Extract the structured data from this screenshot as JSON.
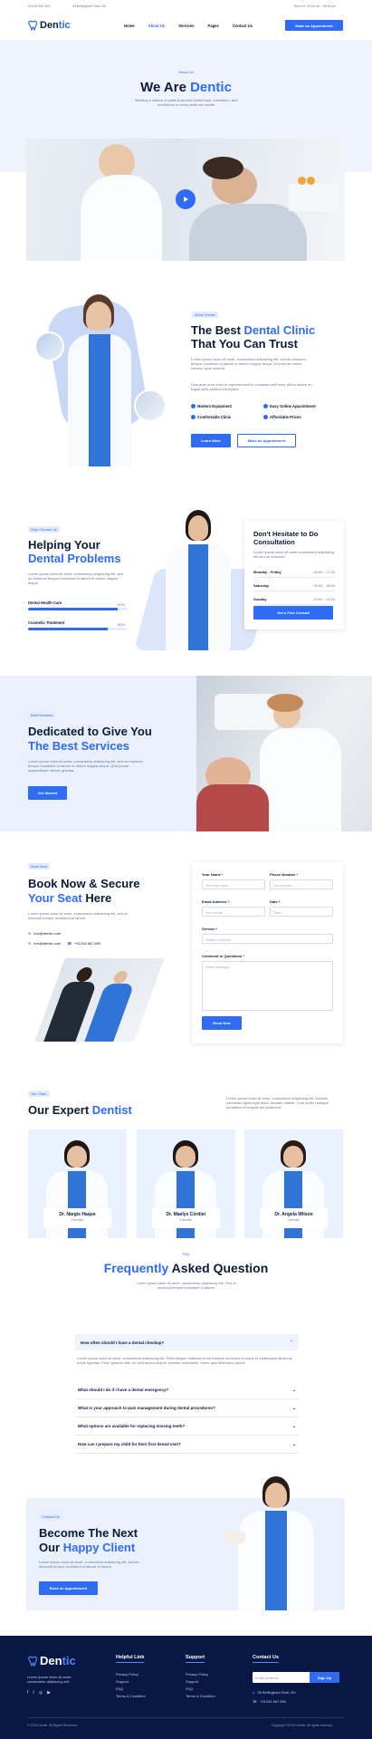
{
  "topbar": {
    "phone": "+01234 567 890",
    "address": "35 Bellingham Park, NV",
    "hours": "Mon-Fri: 09:00 am - 05:00 pm"
  },
  "nav": {
    "brand": "Dentic",
    "brand_prefix": "Den",
    "brand_suffix": "tic",
    "items": [
      "Home",
      "About Us",
      "Services",
      "Pages",
      "Contact Us"
    ],
    "active": "About Us",
    "cta": "Make an Appointment"
  },
  "hero": {
    "breadcrumb": "About Us",
    "title_a": "We Are ",
    "title_b": "Dentic",
    "sub": "Building a culture of patient-centred dental care, innovation, and excellence in every smile we create."
  },
  "about": {
    "tag": "About Dentic",
    "title_a": "The Best ",
    "title_b": "Dental Clinic",
    "title_c": "That You Can Trust",
    "p1": "Lorem ipsum dolor sit amet, consectetur adipiscing elit, sed do eiusmod tempor incididunt ut labore et dolore magna aliqua. Ut enim ad minim veniam, quis nostrud.",
    "p2": "Duis aute irure dolor in reprehenderit in voluptate velit esse cillum dolore eu fugiat nulla pariatur excepteur.",
    "features": [
      "Modern Equipment",
      "Easy Online Appointment",
      "Comfortable Clinic",
      "Affordable Prices"
    ],
    "btn1": "Learn More",
    "btn2": "Make an Appointment"
  },
  "problems": {
    "tag": "Why Choose Us",
    "title_a": "Helping Your",
    "title_b": "Dental Problems",
    "text": "Lorem ipsum dolor sit amet, consectetur adipiscing elit, sed do eiusmod tempor incididunt ut labore et dolore magna aliqua.",
    "skills": [
      {
        "label": "Dental Health Care",
        "value": "90%",
        "pct": 90
      },
      {
        "label": "Cosmetic Treatment",
        "value": "80%",
        "pct": 80
      }
    ],
    "consult": {
      "title": "Don't Hesitate to Do Consultation",
      "text": "Lorem ipsum dolor sit amet consectetur adipiscing elit sed do eiusmod.",
      "rows": [
        {
          "day": "Monday - Friday",
          "time": "08:00 - 17:00"
        },
        {
          "day": "Saturday",
          "time": "09:00 - 15:00"
        },
        {
          "day": "Sunday",
          "time": "10:00 - 13:00"
        }
      ],
      "btn": "Get a Free Consult"
    }
  },
  "services": {
    "tag": "Best Services",
    "title_a": "Dedicated to Give You",
    "title_b": "The Best Services",
    "text": "Lorem ipsum dolor sit amet, consectetur adipiscing elit, sed do eiusmod tempor incididunt ut labore et dolore magna aliqua. Quis ipsum suspendisse ultrices gravida.",
    "btn": "Get Started"
  },
  "booking": {
    "tag": "Book Now",
    "title_a": "Book Now & Secure",
    "title_b": "Your Seat ",
    "title_c": "Here",
    "text": "Lorem ipsum dolor sit amet, consectetur adipiscing elit, sed do eiusmod tempor incididunt ut labore.",
    "email": "info@dentic.com",
    "phone": "+01234 567 890",
    "form": {
      "name_label": "Your Name *",
      "name_ph": "Your full name",
      "phone_label": "Phone Number *",
      "phone_ph": "Your phone",
      "email_label": "Email Address *",
      "email_ph": "Your email",
      "date_label": "Date *",
      "date_ph": "Date",
      "service_label": "Service *",
      "service_ph": "Select a service",
      "comment_label": "Comment or Questions *",
      "comment_ph": "Write message",
      "submit": "Book Now"
    }
  },
  "team": {
    "tag": "Our Team",
    "title_a": "Our Expert ",
    "title_b": "Dentist",
    "text": "Lorem ipsum dolor sit amet, consectetur adipiscing elit. Aenean commodo ligula eget dolor. Aenean massa. Cum sociis natoque penatibus et magnis dis parturient.",
    "members": [
      {
        "name": "Dr. Nargis Haque",
        "role": "Dentist"
      },
      {
        "name": "Dr. Maelys Cordier",
        "role": "Dentist"
      },
      {
        "name": "Dr. Angela Wilson",
        "role": "Dentist"
      }
    ]
  },
  "faq": {
    "tag": "FAQ",
    "title_a": "Frequently ",
    "title_b": "Asked Question",
    "sub": "Lorem ipsum dolor sit amet, consectetur adipiscing elit. Sed do eiusmod tempor incididunt ut labore.",
    "open_q": "How often should I have a dental checkup?",
    "open_a": "Lorem ipsum dolor sit amet, consectetur adipiscing elit. Pellentesque habitant morbi tristique senectus et netus et malesuada fames ac turpis egestas. Proin gravida nibh vel velit auctor aliquet. Aenean sollicitudin, lorem quis bibendum auctor.",
    "questions": [
      "What should I do if I have a dental emergency?",
      "What is your approach to pain management during dental procedures?",
      "What options are available for replacing missing teeth?",
      "How can I prepare my child for their first dental visit?"
    ]
  },
  "cta": {
    "tag": "Contact Us",
    "title_a": "Become The Next",
    "title_b": "Our ",
    "title_c": "Happy Client",
    "text": "Lorem ipsum dolor sit amet, consectetur adipiscing elit, sed do eiusmod tempor incididunt ut labore et dolore.",
    "btn": "Book an Appointment"
  },
  "footer": {
    "about": "Lorem ipsum dolor sit amet, consectetur adipiscing elit.",
    "cols": [
      {
        "title": "Helpful Link",
        "links": [
          "Privacy Policy",
          "Support",
          "FAQ",
          "Terms & Condition"
        ]
      },
      {
        "title": "Support",
        "links": [
          "Privacy Policy",
          "Support",
          "FAQ",
          "Terms & Condition"
        ]
      }
    ],
    "contact_title": "Contact Us",
    "email_ph": "Email Address",
    "signup": "Sign Up",
    "addr": "35 Bellingham Park, NV",
    "phone": "+01234 567 890",
    "copy": "© 2024 Dentic. All Rights Reserved.",
    "copy2": "Copyright ©2024 Dentic. All rights reserved."
  },
  "colors": {
    "accent": "#2f6bf5",
    "dark": "#0b1b3a",
    "pale": "#eef3fd",
    "footer": "#081845"
  }
}
